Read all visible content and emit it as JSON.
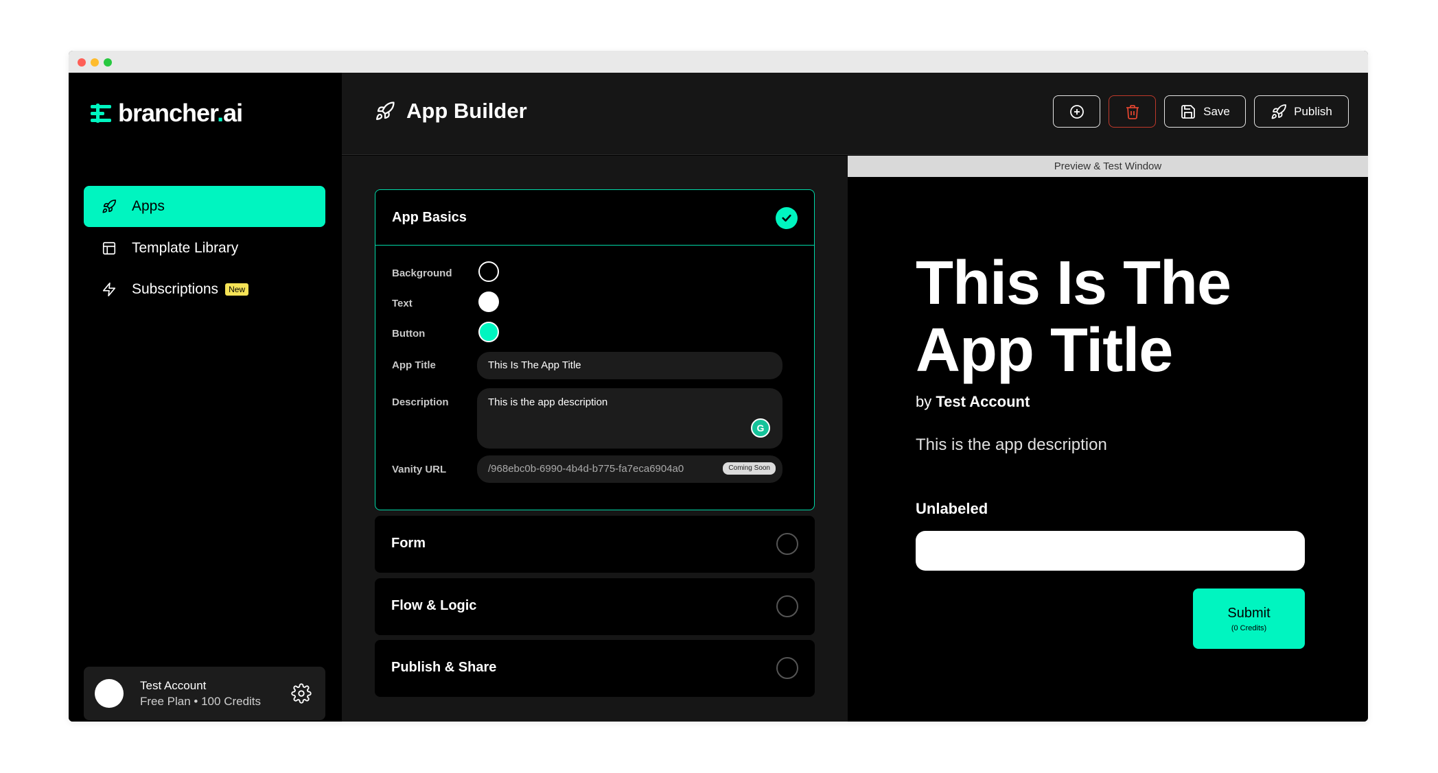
{
  "brand": {
    "name_main": "brancher",
    "name_dot": ".",
    "name_tld": "ai",
    "accent": "#00f5c0"
  },
  "sidebar": {
    "items": [
      {
        "label": "Apps",
        "icon": "rocket-icon",
        "active": true
      },
      {
        "label": "Template Library",
        "icon": "layout-icon",
        "active": false
      },
      {
        "label": "Subscriptions",
        "icon": "lightning-icon",
        "active": false,
        "badge": "New"
      }
    ],
    "account": {
      "name": "Test Account",
      "plan": "Free Plan • 100 Credits"
    }
  },
  "header": {
    "title": "App Builder",
    "buttons": {
      "add_icon": "plus-circle-icon",
      "delete_icon": "trash-icon",
      "save_label": "Save",
      "publish_label": "Publish"
    }
  },
  "builder": {
    "sections": [
      {
        "title": "App Basics",
        "complete": true
      },
      {
        "title": "Form",
        "complete": false
      },
      {
        "title": "Flow & Logic",
        "complete": false
      },
      {
        "title": "Publish & Share",
        "complete": false
      }
    ],
    "basics": {
      "background_label": "Background",
      "text_label": "Text",
      "button_label": "Button",
      "colors": {
        "background": "#000000",
        "text": "#ffffff",
        "button": "#00f5c0"
      },
      "app_title_label": "App Title",
      "app_title_value": "This Is The App Title",
      "description_label": "Description",
      "description_value": "This is the app description",
      "vanity_label": "Vanity URL",
      "vanity_value": "/968ebc0b-6990-4b4d-b775-fa7eca6904a0",
      "coming_soon": "Coming Soon"
    }
  },
  "preview": {
    "bar_label": "Preview & Test Window",
    "title": "This Is The App Title",
    "by": "by",
    "author": "Test Account",
    "description": "This is the app description",
    "field_label": "Unlabeled",
    "submit_label": "Submit",
    "submit_credits": "(0 Credits)"
  }
}
